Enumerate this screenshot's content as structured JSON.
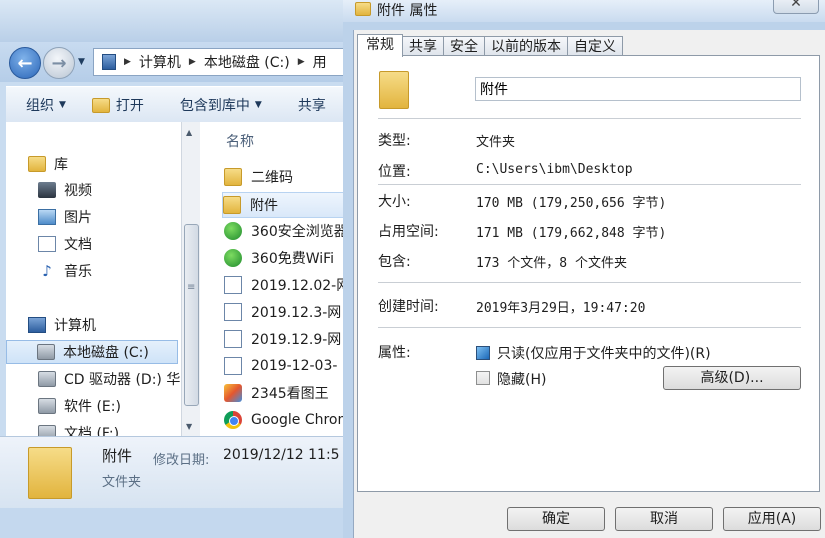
{
  "explorer": {
    "address": {
      "crumbs": [
        "计算机",
        "本地磁盘 (C:)",
        "用"
      ]
    },
    "toolbar": {
      "organize": "组织",
      "open": "打开",
      "include": "包含到库中",
      "share": "共享"
    },
    "nav": {
      "libraries": "库",
      "videos": "视频",
      "pictures": "图片",
      "documents": "文档",
      "music": "音乐",
      "computer": "计算机",
      "local_disk": "本地磁盘 (C:)",
      "cd_drive": "CD 驱动器 (D:) 华",
      "software": "软件 (E:)",
      "docs_drive": "文档 (F:)"
    },
    "files": {
      "column_name": "名称",
      "items": [
        "二维码",
        "附件",
        "360安全浏览器",
        "360免费WiFi",
        "2019.12.02-网",
        "2019.12.3-网",
        "2019.12.9-网",
        "2019-12-03-",
        "2345看图王",
        "Google Chrome"
      ]
    },
    "details": {
      "name": "附件",
      "modified_label": "修改日期:",
      "modified_value": "2019/12/12 11:5",
      "kind": "文件夹"
    }
  },
  "dialog": {
    "title": "附件 属性",
    "close": "✕",
    "tabs": [
      "常规",
      "共享",
      "安全",
      "以前的版本",
      "自定义"
    ],
    "folder_name": "附件",
    "type_label": "类型:",
    "type_value": "文件夹",
    "location_label": "位置:",
    "location_value": "C:\\Users\\ibm\\Desktop",
    "size_label": "大小:",
    "size_value": "170 MB (179,250,656 字节)",
    "size_on_disk_label": "占用空间:",
    "size_on_disk_value": "171 MB (179,662,848 字节)",
    "contains_label": "包含:",
    "contains_value": "173 个文件，8 个文件夹",
    "created_label": "创建时间:",
    "created_value": "2019年3月29日，19:47:20",
    "attributes_label": "属性:",
    "readonly_label": "只读(仅应用于文件夹中的文件)(R)",
    "readonly_checked": true,
    "hidden_label": "隐藏(H)",
    "hidden_checked": false,
    "advanced_button": "高级(D)...",
    "ok_button": "确定",
    "cancel_button": "取消",
    "apply_button": "应用(A)"
  }
}
